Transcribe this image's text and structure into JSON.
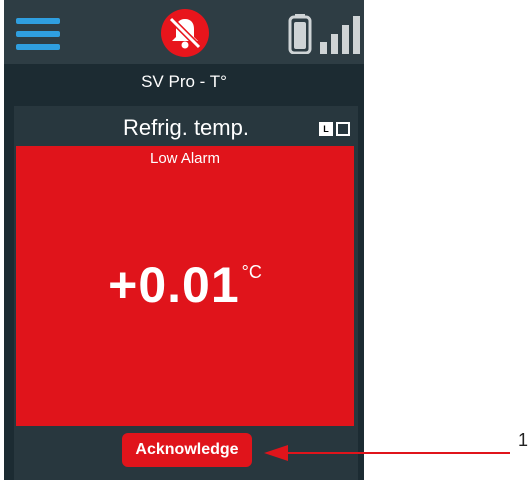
{
  "header": {
    "menu_icon": "hamburger-menu-icon",
    "alarm_icon": "bell-muted-icon",
    "battery_icon": "battery-icon",
    "signal_icon": "signal-strength-icon"
  },
  "device": {
    "name": "SV Pro - T°"
  },
  "tile": {
    "title": "Refrig. temp.",
    "mode_labels": [
      "L",
      ""
    ],
    "alarm_status": "Low Alarm",
    "value": "+0.01",
    "unit": "°C",
    "acknowledge_label": "Acknowledge"
  },
  "callout": {
    "number": "1"
  },
  "colors": {
    "screen_bg": "#1c2b32",
    "status_bar_bg": "#2e3d44",
    "tile_bg": "#28373e",
    "alarm_red": "#e0141b",
    "accent_blue": "#2f9fe0",
    "mute_red": "#e8151c"
  }
}
